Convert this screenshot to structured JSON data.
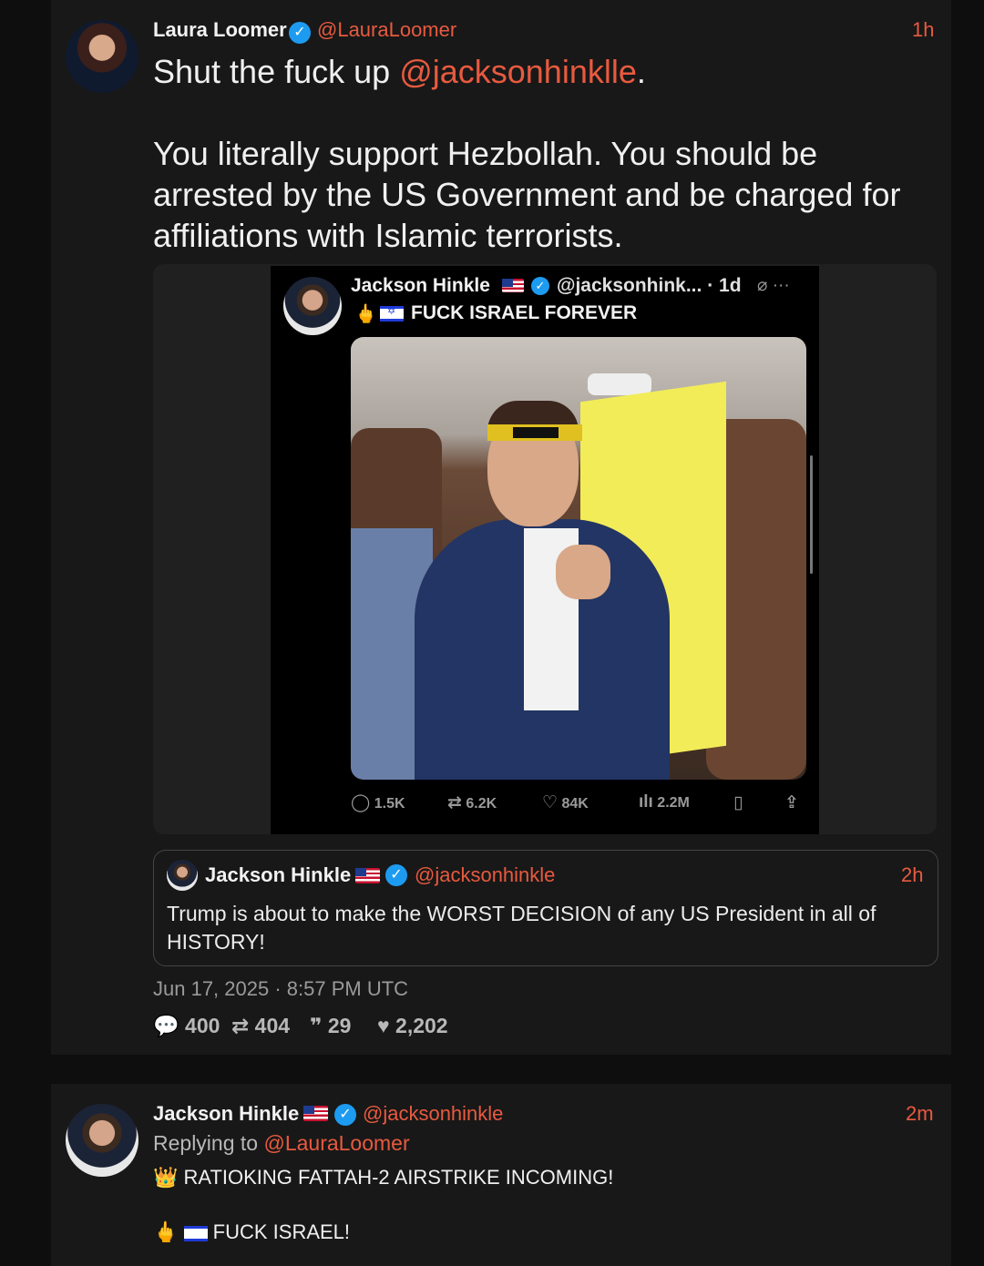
{
  "main_tweet": {
    "author_name": "Laura Loomer",
    "author_handle": "@LauraLoomer",
    "time": "1h",
    "text_before": "Shut the fuck up ",
    "mention": "@jacksonhinklle",
    "text_after": ".",
    "paragraph2": "You literally support Hezbollah. You should be arrested by the US Government and be charged for affiliations with Islamic terrorists.",
    "date": "Jun 17, 2025 · 8:57 PM UTC",
    "stats": {
      "replies": "400",
      "retweets": "404",
      "quotes": "29",
      "likes": "2,202"
    }
  },
  "embedded_screenshot": {
    "author_name": "Jackson Hinkle",
    "author_handle_time": "@jacksonhink... · 1d",
    "text": "FUCK ISRAEL FOREVER",
    "metrics": {
      "replies": "1.5K",
      "retweets": "6.2K",
      "likes": "84K",
      "views": "2.2M"
    }
  },
  "quoted_tweet": {
    "author_name": "Jackson Hinkle",
    "author_handle": "@jacksonhinkle",
    "time": "2h",
    "text": "Trump is about to make the WORST DECISION of any US President in all of HISTORY!"
  },
  "reply_tweet": {
    "author_name": "Jackson Hinkle",
    "author_handle": "@jacksonhinkle",
    "time": "2m",
    "replying_label": "Replying to ",
    "replying_to": "@LauraLoomer",
    "line1": "RATIOKING FATTAH-2 AIRSTRIKE INCOMING!",
    "line2": "FUCK ISRAEL!"
  },
  "colors": {
    "accent": "#e85a3f",
    "verified": "#1d9bf0",
    "background": "#0e0e0e",
    "card": "#181818"
  },
  "icons": [
    "verified-icon",
    "us-flag-icon",
    "israel-flag-icon",
    "reply-icon",
    "retweet-icon",
    "quote-icon",
    "like-icon",
    "views-icon",
    "bookmark-icon",
    "share-icon",
    "crown-icon",
    "middle-finger-icon"
  ]
}
